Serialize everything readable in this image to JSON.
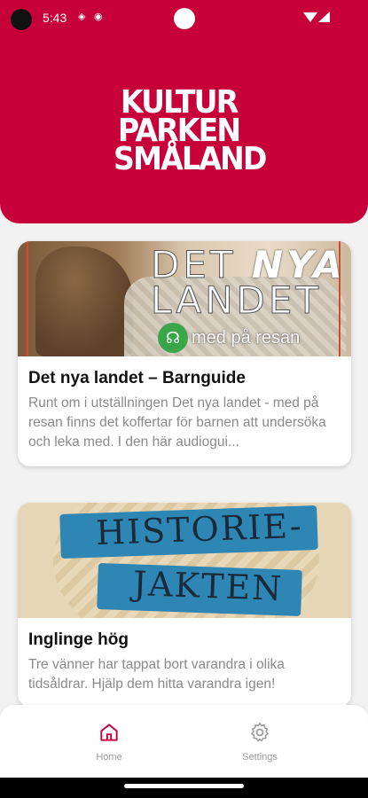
{
  "status_bar": {
    "time": "5:43",
    "icons": [
      "nfc-icon",
      "location-icon",
      "wifi-icon",
      "signal-icon"
    ]
  },
  "header": {
    "logo_lines": [
      "KULTUR",
      "PARKEN",
      "SMÅLAND"
    ],
    "background_color": "#c8003a"
  },
  "cards": [
    {
      "image_text": {
        "line1_prefix": "DET ",
        "line1_emph": "NYA",
        "line2": "LANDET",
        "badge_text": "med på resan"
      },
      "title": "Det nya landet – Barnguide",
      "description": "Runt om i utställningen Det nya landet - med på resan finns det koffertar för barnen att undersöka och leka med. I den här audiogui..."
    },
    {
      "image_text": {
        "line1": "HISTORIE-",
        "line2": "JAKTEN"
      },
      "title": "Inglinge hög",
      "description": "Tre vänner har tappat bort varandra i olika tidsåldrar. Hjälp dem hitta varandra igen!"
    }
  ],
  "bottom_nav": {
    "items": [
      {
        "label": "Home",
        "icon": "home-icon",
        "active": true,
        "color": "#c8003a"
      },
      {
        "label": "Settings",
        "icon": "gear-icon",
        "active": false,
        "color": "#9a9a9a"
      }
    ]
  }
}
